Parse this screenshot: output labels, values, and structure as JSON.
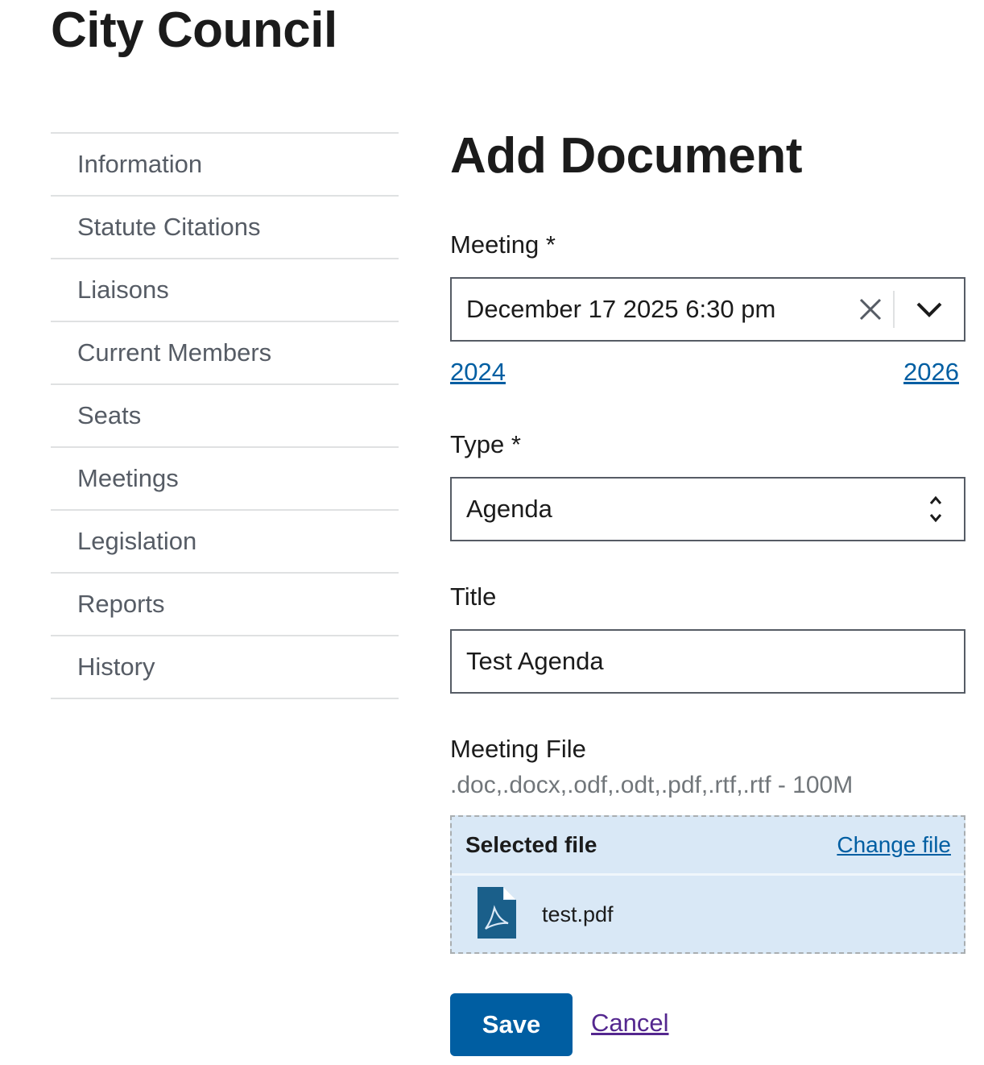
{
  "site": {
    "title": "City Council"
  },
  "sidebar": {
    "items": [
      {
        "label": "Information"
      },
      {
        "label": "Statute Citations"
      },
      {
        "label": "Liaisons"
      },
      {
        "label": "Current Members"
      },
      {
        "label": "Seats"
      },
      {
        "label": "Meetings"
      },
      {
        "label": "Legislation"
      },
      {
        "label": "Reports"
      },
      {
        "label": "History"
      }
    ]
  },
  "form": {
    "heading": "Add Document",
    "meeting": {
      "label": "Meeting *",
      "value": "December 17 2025 6:30 pm",
      "prev_year": "2024",
      "next_year": "2026"
    },
    "type": {
      "label": "Type *",
      "value": "Agenda"
    },
    "title": {
      "label": "Title",
      "value": "Test Agenda"
    },
    "file": {
      "label": "Meeting File",
      "hint": ".doc,.docx,.odf,.odt,.pdf,.rtf,.rtf - 100M",
      "selected_heading": "Selected file",
      "change_label": "Change file",
      "filename": "test.pdf",
      "icon": "pdf-file-icon"
    },
    "save_label": "Save",
    "cancel_label": "Cancel"
  },
  "colors": {
    "primary": "#005ea2",
    "dropzone_bg": "#d9e8f6",
    "visited_link": "#54278f",
    "nav_text": "#565c65"
  }
}
